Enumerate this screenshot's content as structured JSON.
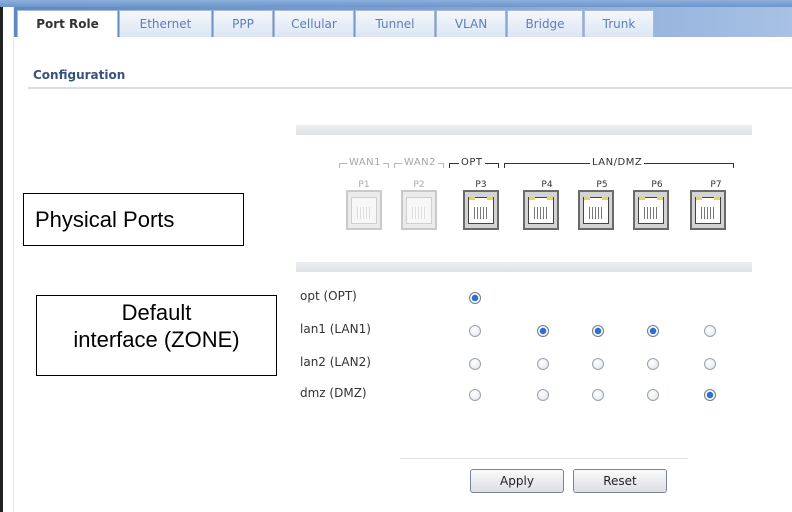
{
  "tabs": [
    {
      "label": "Port Role",
      "active": true
    },
    {
      "label": "Ethernet",
      "active": false
    },
    {
      "label": "PPP",
      "active": false
    },
    {
      "label": "Cellular",
      "active": false
    },
    {
      "label": "Tunnel",
      "active": false
    },
    {
      "label": "VLAN",
      "active": false
    },
    {
      "label": "Bridge",
      "active": false
    },
    {
      "label": "Trunk",
      "active": false
    }
  ],
  "section_title": "Configuration",
  "port_groups": [
    {
      "label": "WAN1",
      "enabled": false
    },
    {
      "label": "WAN2",
      "enabled": false
    },
    {
      "label": "OPT",
      "enabled": true
    },
    {
      "label": "LAN/DMZ",
      "enabled": true
    }
  ],
  "ports": [
    {
      "label": "P1",
      "enabled": false
    },
    {
      "label": "P2",
      "enabled": false
    },
    {
      "label": "P3",
      "enabled": true
    },
    {
      "label": "P4",
      "enabled": true
    },
    {
      "label": "P5",
      "enabled": true
    },
    {
      "label": "P6",
      "enabled": true
    },
    {
      "label": "P7",
      "enabled": true
    }
  ],
  "interfaces": [
    {
      "label": "opt (OPT)",
      "selection": [
        true,
        null,
        null,
        null,
        null
      ]
    },
    {
      "label": "lan1 (LAN1)",
      "selection": [
        false,
        true,
        true,
        true,
        false
      ]
    },
    {
      "label": "lan2 (LAN2)",
      "selection": [
        false,
        false,
        false,
        false,
        false
      ]
    },
    {
      "label": "dmz (DMZ)",
      "selection": [
        false,
        false,
        false,
        false,
        true
      ]
    }
  ],
  "buttons": {
    "apply": "Apply",
    "reset": "Reset"
  },
  "annotations": {
    "physical_ports": "Physical Ports",
    "default_interface_line1": "Default",
    "default_interface_line2": "interface (ZONE)"
  },
  "colors": {
    "tab_bar": "#6c95ca",
    "radio_selected": "#2d6fd2",
    "section_title": "#39537d"
  }
}
